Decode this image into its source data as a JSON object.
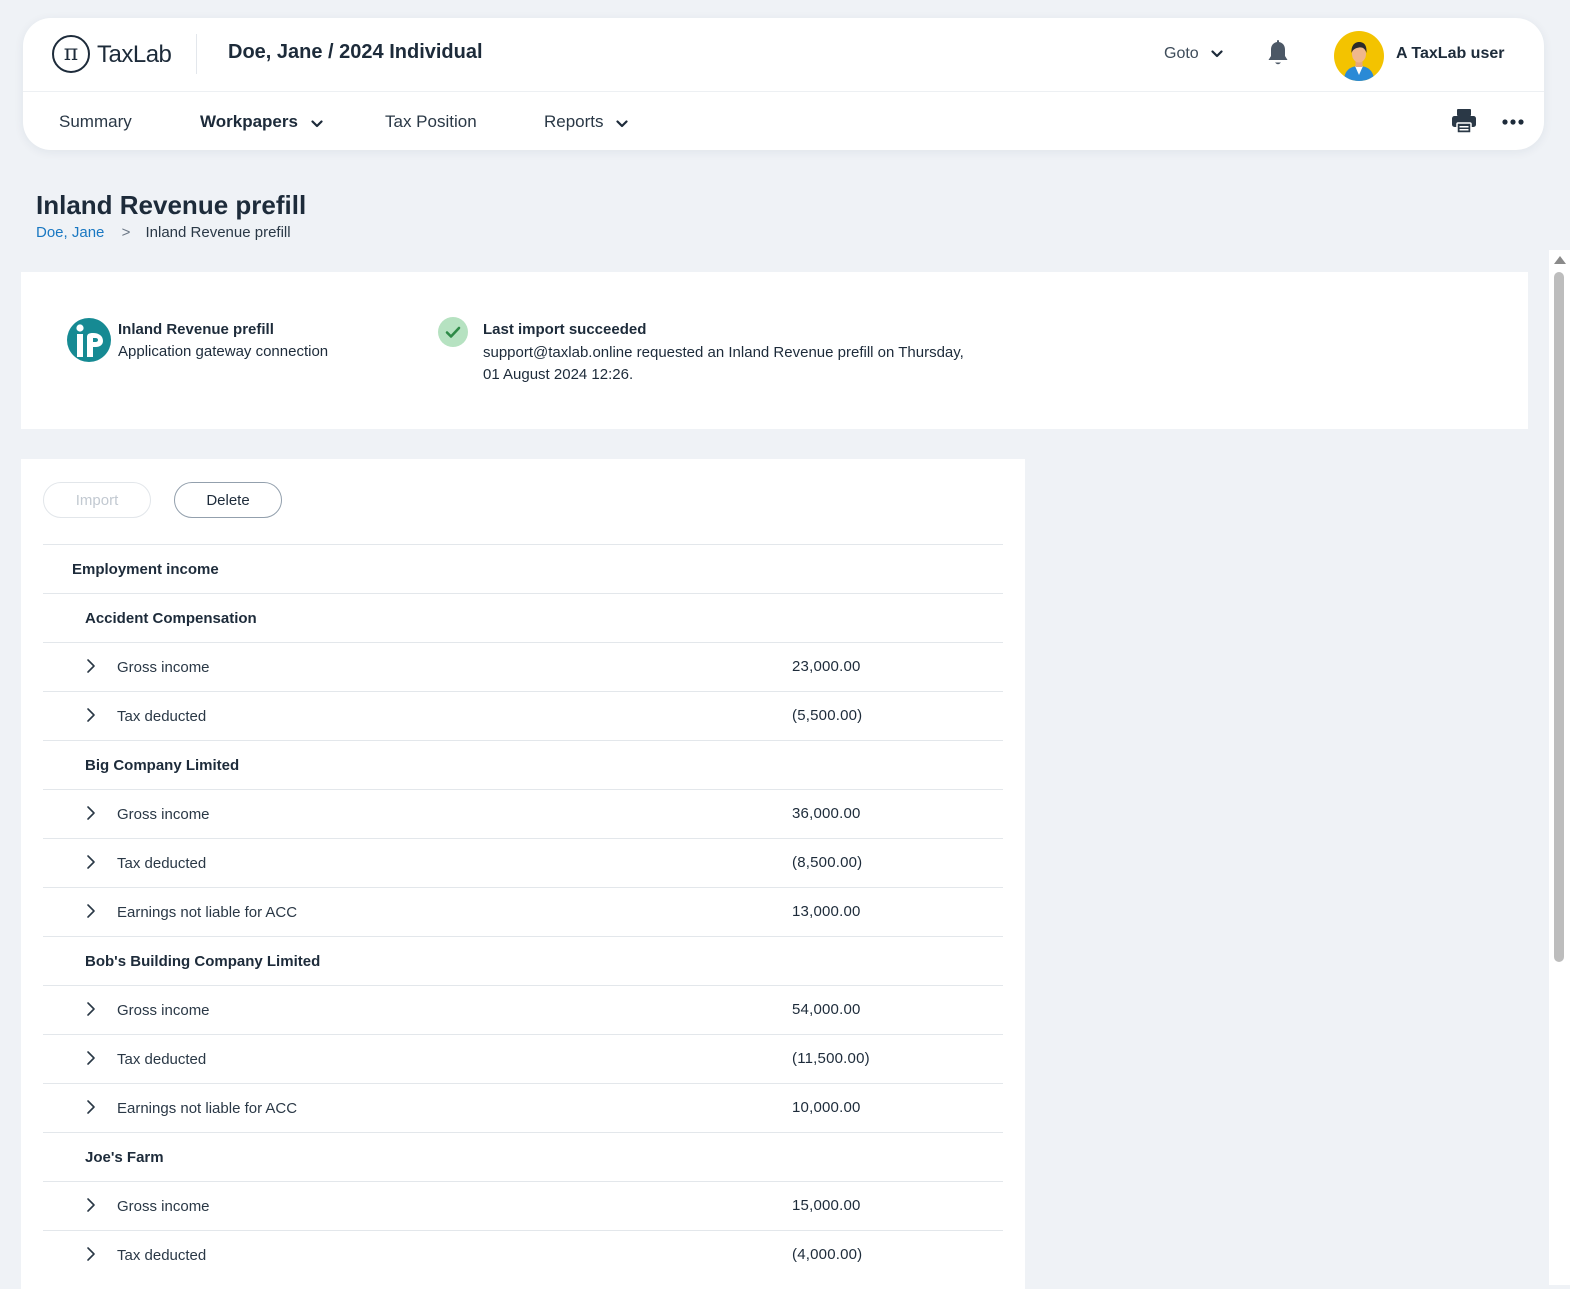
{
  "header": {
    "logo_symbol": "π",
    "logo_text": "TaxLab",
    "client_title": "Doe, Jane / 2024 Individual",
    "goto_label": "Goto",
    "user_name": "A TaxLab user"
  },
  "nav": {
    "summary": "Summary",
    "workpapers": "Workpapers",
    "tax_position": "Tax Position",
    "reports": "Reports",
    "active": "Workpapers"
  },
  "page": {
    "title": "Inland Revenue prefill",
    "breadcrumb": [
      "Doe, Jane",
      ">",
      "Inland Revenue prefill"
    ]
  },
  "connection": {
    "name": "Inland Revenue prefill",
    "type": "Application gateway connection"
  },
  "status": {
    "title": "Last import succeeded",
    "message_line1": "support@taxlab.online requested an Inland Revenue prefill on Thursday,",
    "message_line2": "01 August 2024 12:26."
  },
  "actions": {
    "import_label": "Import",
    "delete_label": "Delete"
  },
  "rows": [
    {
      "kind": "section",
      "label": "Employment income"
    },
    {
      "kind": "group",
      "label": "Accident Compensation"
    },
    {
      "kind": "item",
      "label": "Gross income",
      "value": "23,000.00"
    },
    {
      "kind": "item",
      "label": "Tax deducted",
      "value": "(5,500.00)"
    },
    {
      "kind": "group",
      "label": "Big Company Limited"
    },
    {
      "kind": "item",
      "label": "Gross income",
      "value": "36,000.00"
    },
    {
      "kind": "item",
      "label": "Tax deducted",
      "value": "(8,500.00)"
    },
    {
      "kind": "item",
      "label": "Earnings not liable for ACC",
      "value": "13,000.00"
    },
    {
      "kind": "group",
      "label": "Bob's Building Company Limited"
    },
    {
      "kind": "item",
      "label": "Gross income",
      "value": "54,000.00"
    },
    {
      "kind": "item",
      "label": "Tax deducted",
      "value": "(11,500.00)"
    },
    {
      "kind": "item",
      "label": "Earnings not liable for ACC",
      "value": "10,000.00"
    },
    {
      "kind": "group",
      "label": "Joe's Farm"
    },
    {
      "kind": "item",
      "label": "Gross income",
      "value": "15,000.00"
    },
    {
      "kind": "item",
      "label": "Tax deducted",
      "value": "(4,000.00)"
    }
  ],
  "colors": {
    "page_background": "#eff2f6",
    "link": "#1a78c2",
    "success": "#b6e2c1",
    "success_check": "#2e8a47",
    "ir_brand": "#168a93",
    "avatar_background": "#f3c300"
  },
  "icons": {
    "logo": "pi-icon",
    "goto_dropdown": "chevron-down-icon",
    "notifications": "bell-icon",
    "print": "printer-icon",
    "more": "more-horizontal-icon",
    "status": "check-icon",
    "row_expand": "chevron-right-icon"
  }
}
